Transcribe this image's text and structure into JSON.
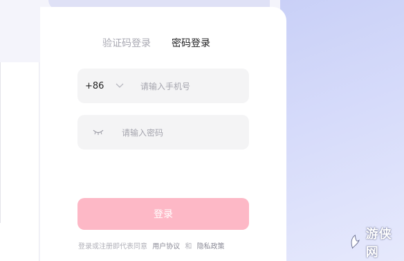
{
  "tabs": [
    {
      "label": "验证码登录",
      "active": false
    },
    {
      "label": "密码登录",
      "active": true
    }
  ],
  "phone": {
    "country_code": "+86",
    "placeholder": "请输入手机号"
  },
  "password": {
    "placeholder": "请输入密码"
  },
  "login_button": {
    "label": "登录"
  },
  "agreement": {
    "prefix": "登录或注册即代表同意",
    "user_agreement": "用户协议",
    "and": "和",
    "privacy_policy": "隐私政策"
  },
  "watermark": {
    "text": "游侠网"
  },
  "colors": {
    "button": "#fdb8c6",
    "input_bg": "#f4f4f5",
    "active_tab": "#1d1d1f",
    "inactive_tab": "#a8a8b2",
    "right_panel": "#d6dbfa"
  }
}
